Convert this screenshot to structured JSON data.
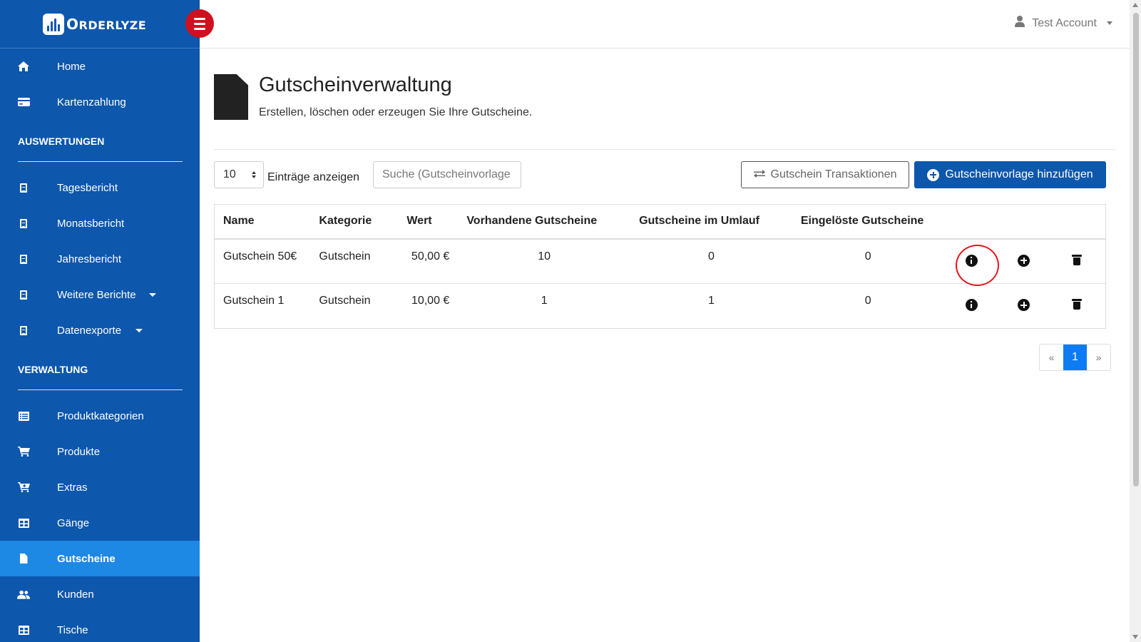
{
  "brand": {
    "name_first": "O",
    "name_rest": "RDERLYZE"
  },
  "account": {
    "name": "Test Account"
  },
  "sidebar": {
    "top_items": [
      {
        "label": "Home",
        "icon": "home-icon"
      },
      {
        "label": "Kartenzahlung",
        "icon": "credit-card-icon"
      }
    ],
    "sections": [
      {
        "title": "AUSWERTUNGEN",
        "items": [
          {
            "label": "Tagesbericht",
            "icon": "document-icon"
          },
          {
            "label": "Monatsbericht",
            "icon": "document-icon"
          },
          {
            "label": "Jahresbericht",
            "icon": "document-icon"
          },
          {
            "label": "Weitere Berichte",
            "icon": "document-icon"
          },
          {
            "label": "Datenexporte",
            "icon": "document-icon"
          }
        ]
      },
      {
        "title": "VERWALTUNG",
        "items": [
          {
            "label": "Produktkategorien",
            "icon": "list-icon"
          },
          {
            "label": "Produkte",
            "icon": "cart-icon"
          },
          {
            "label": "Extras",
            "icon": "cart-plus-icon"
          },
          {
            "label": "Gänge",
            "icon": "table-icon"
          },
          {
            "label": "Gutscheine",
            "icon": "file-icon"
          },
          {
            "label": "Kunden",
            "icon": "users-icon"
          },
          {
            "label": "Tische",
            "icon": "table-icon"
          }
        ]
      }
    ]
  },
  "page": {
    "title": "Gutscheinverwaltung",
    "subtitle": "Erstellen, löschen oder erzeugen Sie Ihre Gutscheine."
  },
  "controls": {
    "page_length": "10",
    "page_length_label": "Einträge anzeigen",
    "search_placeholder": "Suche (Gutscheinvorlage",
    "transactions_label": "Gutschein Transaktionen",
    "add_label": "Gutscheinvorlage hinzufügen"
  },
  "table": {
    "headers": [
      "Name",
      "Kategorie",
      "Wert",
      "Vorhandene Gutscheine",
      "Gutscheine im Umlauf",
      "Eingelöste Gutscheine"
    ],
    "rows": [
      {
        "name": "Gutschein 50€",
        "category": "Gutschein",
        "value": "50,00 €",
        "available": "10",
        "in_circulation": "0",
        "redeemed": "0"
      },
      {
        "name": "Gutschein 1",
        "category": "Gutschein",
        "value": "10,00 €",
        "available": "1",
        "in_circulation": "1",
        "redeemed": "0"
      }
    ]
  },
  "pagination": {
    "prev": "«",
    "current": "1",
    "next": "»"
  },
  "colors": {
    "sidebar": "#0d57ad",
    "active": "#1e88e5",
    "toggle": "#d0101e",
    "primary": "#0d57ad"
  }
}
